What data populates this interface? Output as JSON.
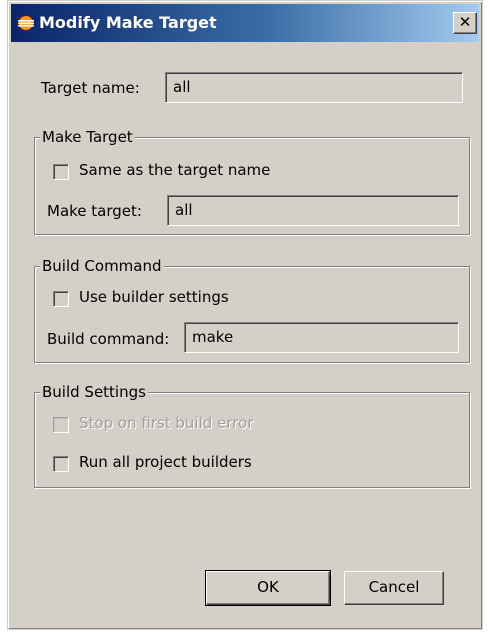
{
  "window": {
    "title": "Modify Make Target",
    "close_glyph": "✕"
  },
  "target_name": {
    "label": "Target name:",
    "value": "all"
  },
  "make_target_group": {
    "title": "Make Target",
    "same_as_target_label": "Same as the target name",
    "same_as_target_checked": false,
    "make_target_label": "Make target:",
    "make_target_value": "all"
  },
  "build_command_group": {
    "title": "Build Command",
    "use_builder_label": "Use builder settings",
    "use_builder_checked": false,
    "build_command_label": "Build command:",
    "build_command_value": "make"
  },
  "build_settings_group": {
    "title": "Build Settings",
    "stop_on_error_label": "Stop on first build error",
    "stop_on_error_checked": false,
    "stop_on_error_enabled": false,
    "run_all_builders_label": "Run all project builders",
    "run_all_builders_checked": false
  },
  "buttons": {
    "ok": "OK",
    "cancel": "Cancel"
  },
  "icons": {
    "app": "eclipse-icon",
    "close": "close-icon"
  }
}
